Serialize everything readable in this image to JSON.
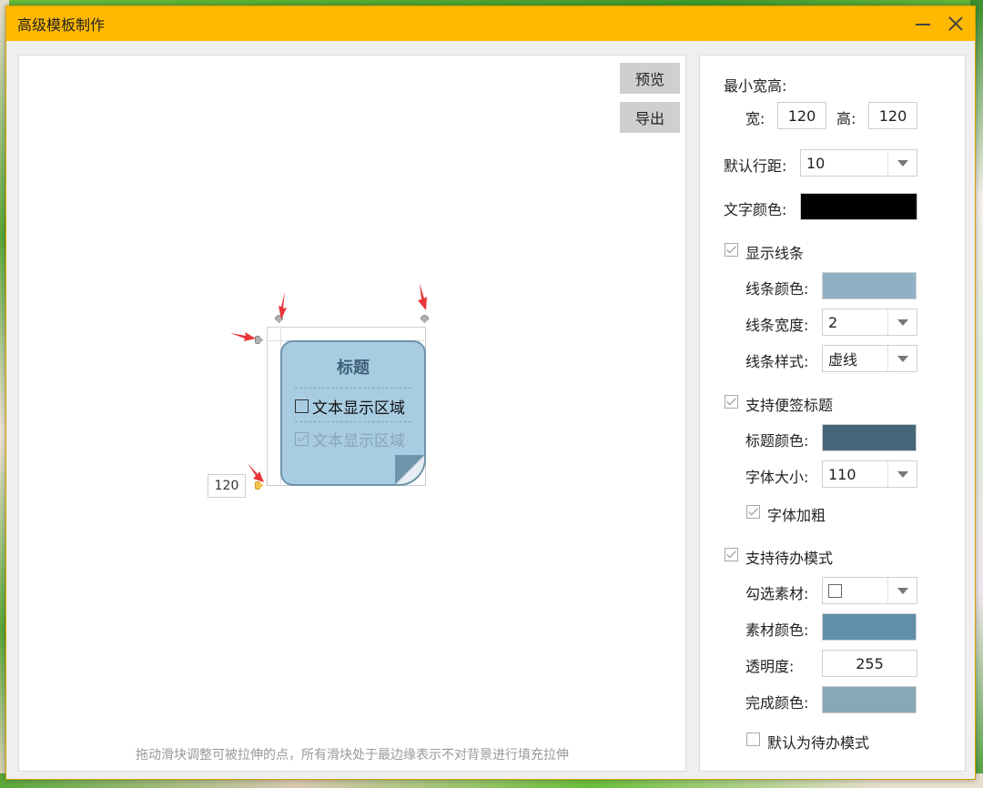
{
  "window": {
    "title": "高级模板制作"
  },
  "toolbar": {
    "preview_label": "预览",
    "export_label": "导出"
  },
  "canvas": {
    "hint": "拖动滑块调整可被拉伸的点，所有滑块处于最边缘表示不对背景进行填充拉伸",
    "stretch_value": "120",
    "note": {
      "title": "标题",
      "item_text": "文本显示区域",
      "done_text": "文本显示区域",
      "background_color": "#a8cde2",
      "title_color": "#3f6279"
    }
  },
  "settings": {
    "min_size_label": "最小宽高:",
    "width_label": "宽:",
    "width_value": "120",
    "height_label": "高:",
    "height_value": "120",
    "line_spacing_label": "默认行距:",
    "line_spacing_value": "10",
    "text_color_label": "文字颜色:",
    "text_color": "#000000",
    "show_lines_label": "显示线条",
    "show_lines_checked": true,
    "line_color_label": "线条颜色:",
    "line_color": "#90b1c5",
    "line_width_label": "线条宽度:",
    "line_width_value": "2",
    "line_style_label": "线条样式:",
    "line_style_value": "虚线",
    "support_title_label": "支持便签标题",
    "support_title_checked": true,
    "title_color_label": "标题颜色:",
    "title_color": "#456579",
    "font_size_label": "字体大小:",
    "font_size_value": "110",
    "bold_label": "字体加粗",
    "bold_checked": true,
    "support_todo_label": "支持待办模式",
    "support_todo_checked": true,
    "check_material_label": "勾选素材:",
    "material_color_label": "素材颜色:",
    "material_color": "#5f8fa9",
    "opacity_label": "透明度:",
    "opacity_value": "255",
    "done_color_label": "完成颜色:",
    "done_color": "#87a8b8",
    "default_todo_label": "默认为待办模式",
    "default_todo_checked": false
  }
}
